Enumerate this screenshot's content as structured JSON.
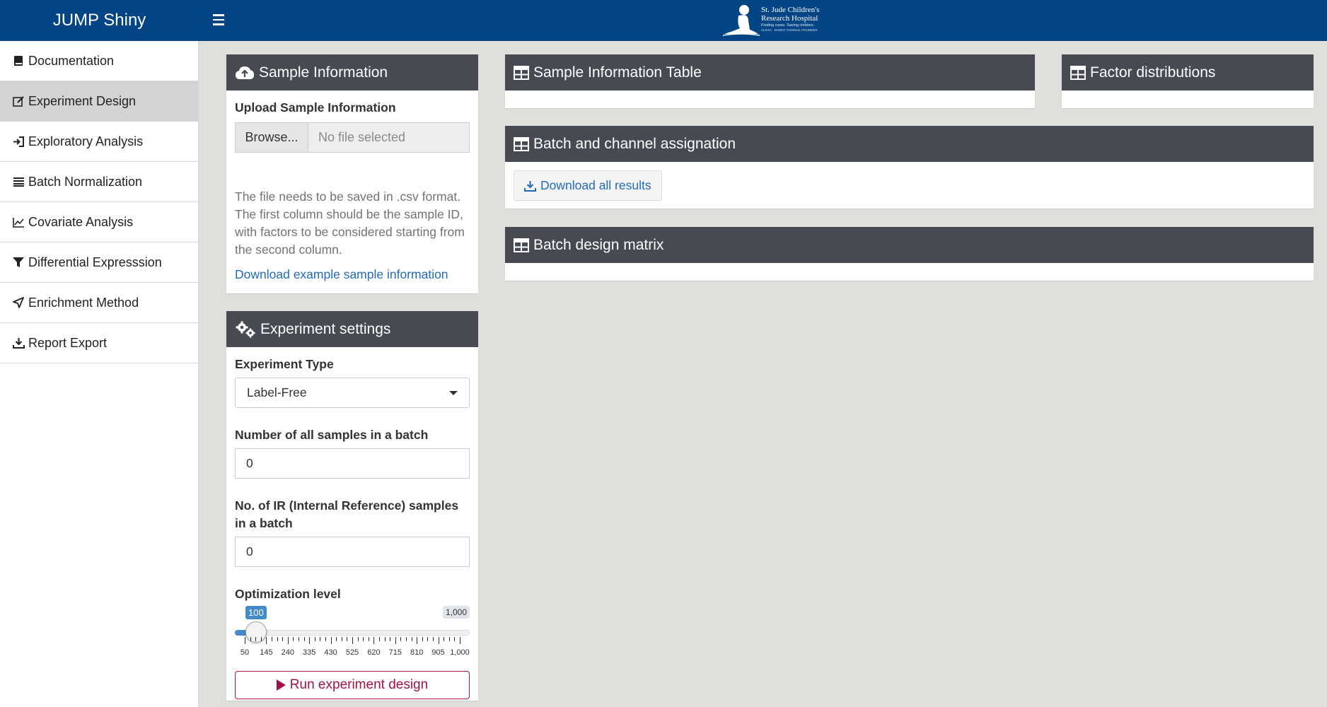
{
  "header": {
    "brand": "JUMP Shiny",
    "logo": {
      "line1": "St. Jude Children's",
      "line2": "Research Hospital",
      "tagline": "Finding cures. Saving children.",
      "founder": "ALSAC · DANNY THOMAS, FOUNDER"
    }
  },
  "sidebar": {
    "items": [
      {
        "label": "Documentation",
        "icon": "book-icon"
      },
      {
        "label": "Experiment Design",
        "icon": "edit-icon",
        "active": true
      },
      {
        "label": "Exploratory Analysis",
        "icon": "sign-in-icon"
      },
      {
        "label": "Batch Normalization",
        "icon": "list-icon"
      },
      {
        "label": "Covariate Analysis",
        "icon": "line-chart-icon"
      },
      {
        "label": "Differential Expresssion",
        "icon": "filter-icon"
      },
      {
        "label": "Enrichment Method",
        "icon": "location-arrow-icon"
      },
      {
        "label": "Report Export",
        "icon": "download-icon"
      }
    ]
  },
  "sample_info": {
    "title": "Sample Information",
    "upload_label": "Upload Sample Information",
    "browse_label": "Browse...",
    "file_placeholder": "No file selected",
    "help_text": "The file needs to be saved in .csv format. The first column should be the sample ID, with factors to be considered starting from the second column.",
    "example_link": "Download example sample information"
  },
  "experiment_settings": {
    "title": "Experiment settings",
    "type_label": "Experiment Type",
    "type_value": "Label-Free",
    "samples_label": "Number of all samples in a batch",
    "samples_value": "0",
    "ir_label": "No. of IR (Internal Reference) samples in a batch",
    "ir_value": "0",
    "opt_label": "Optimization level",
    "slider": {
      "min": 50,
      "max": 1000,
      "value": 100,
      "value_label": "100",
      "max_label": "1,000",
      "tick_labels": [
        "50",
        "145",
        "240",
        "335",
        "430",
        "525",
        "620",
        "715",
        "810",
        "905",
        "1,000"
      ]
    },
    "run_label": "Run experiment design"
  },
  "sample_table": {
    "title": "Sample Information Table"
  },
  "factor_dist": {
    "title": "Factor distributions"
  },
  "batch_channel": {
    "title": "Batch and channel assignation",
    "download_label": "Download all results"
  },
  "batch_matrix": {
    "title": "Batch design matrix"
  },
  "colors": {
    "header_bg": "#034485",
    "box_header_bg": "#474a52",
    "active_sidebar": "#d3d3d3",
    "link": "#1f6ac0",
    "run_button": "#a3114a",
    "slider": "#428bca"
  }
}
